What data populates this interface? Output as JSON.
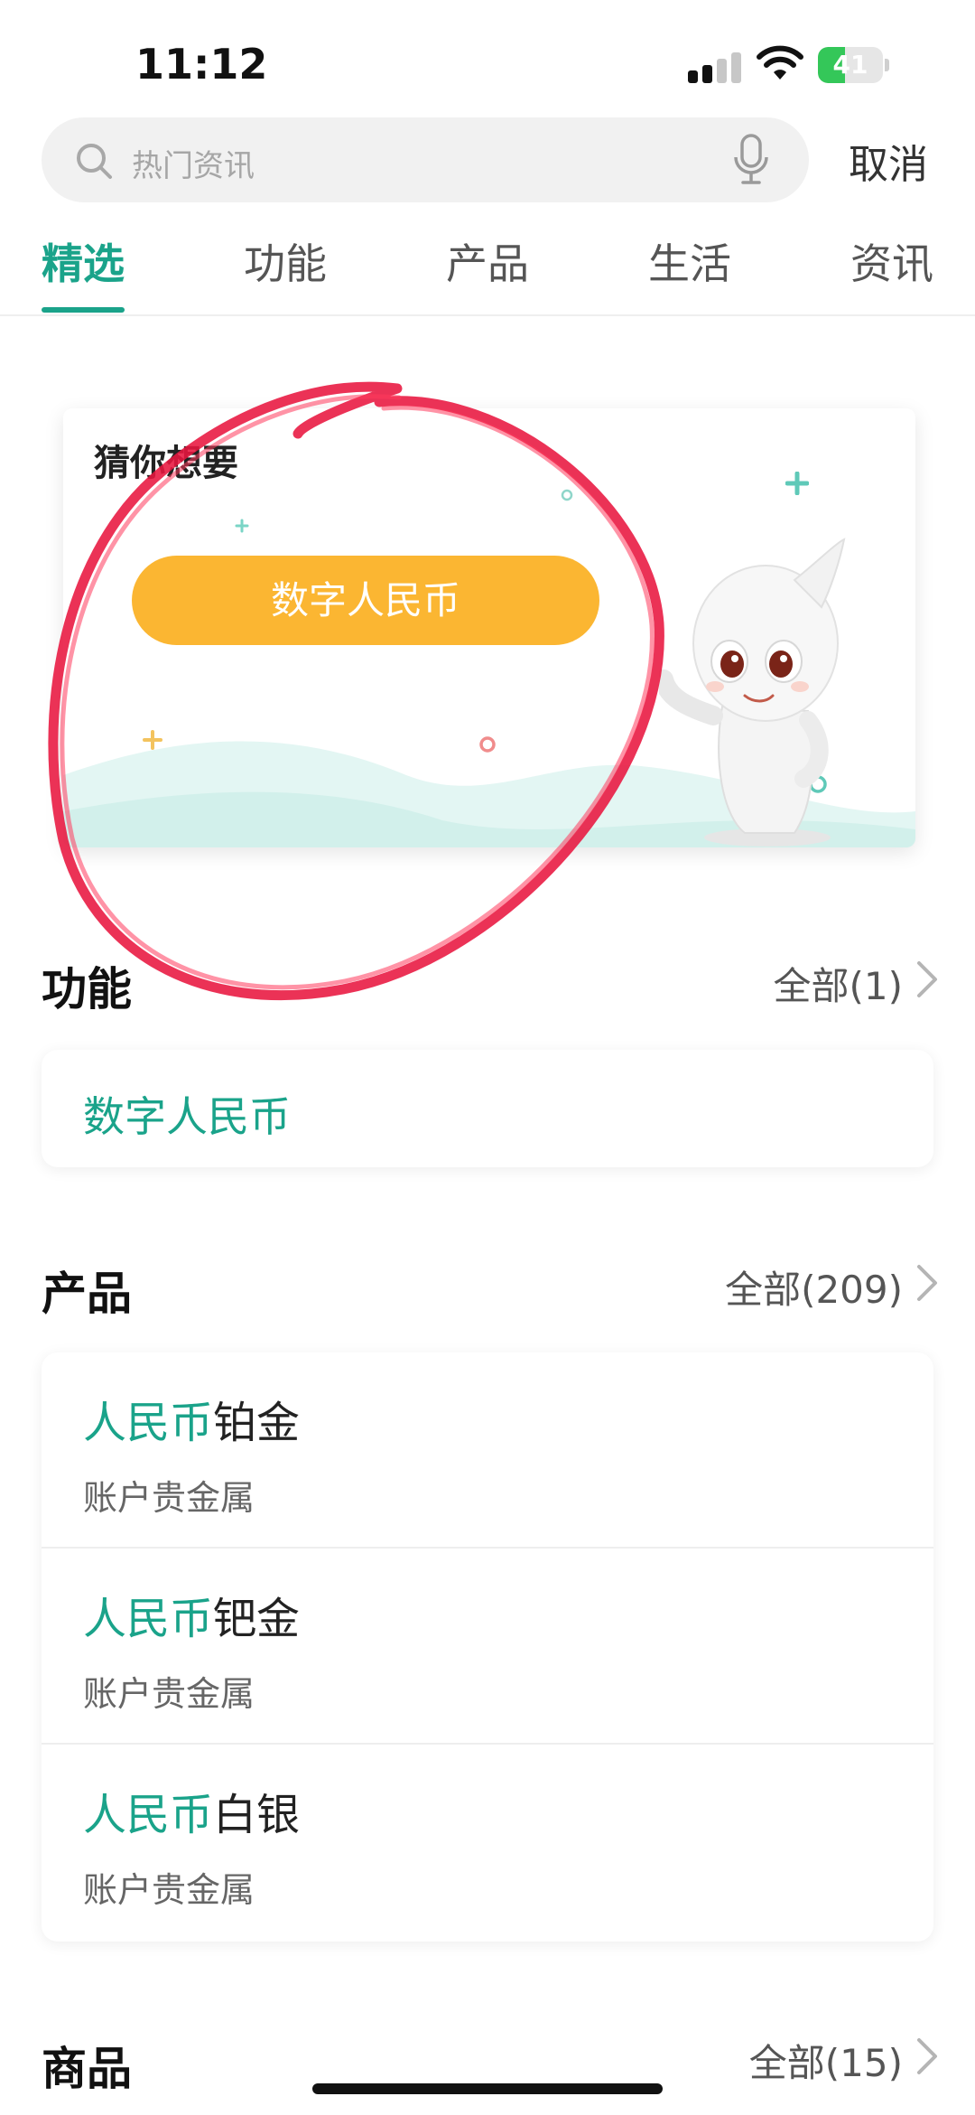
{
  "status_bar": {
    "time": "11:12",
    "battery_percent": "41",
    "battery_level": 0.41
  },
  "search": {
    "placeholder": "热门资讯",
    "cancel_label": "取消"
  },
  "tabs": [
    {
      "label": "精选",
      "active": true
    },
    {
      "label": "功能",
      "active": false
    },
    {
      "label": "产品",
      "active": false
    },
    {
      "label": "生活",
      "active": false
    },
    {
      "label": "资讯",
      "active": false
    }
  ],
  "guess_card": {
    "title": "猜你想要",
    "suggestion": "数字人民币"
  },
  "function_section": {
    "title": "功能",
    "more_label": "全部(1)",
    "items": [
      "数字人民币"
    ]
  },
  "product_section": {
    "title": "产品",
    "more_label": "全部(209)",
    "items": [
      {
        "highlight": "人民币",
        "rest": "铂金",
        "subtitle": "账户贵金属"
      },
      {
        "highlight": "人民币",
        "rest": "钯金",
        "subtitle": "账户贵金属"
      },
      {
        "highlight": "人民币",
        "rest": "白银",
        "subtitle": "账户贵金属"
      }
    ]
  },
  "goods_section": {
    "title": "商品",
    "more_label": "全部(15)"
  },
  "colors": {
    "accent": "#1aa38a",
    "pill": "#fbb632",
    "annotation": "#e8163f"
  }
}
